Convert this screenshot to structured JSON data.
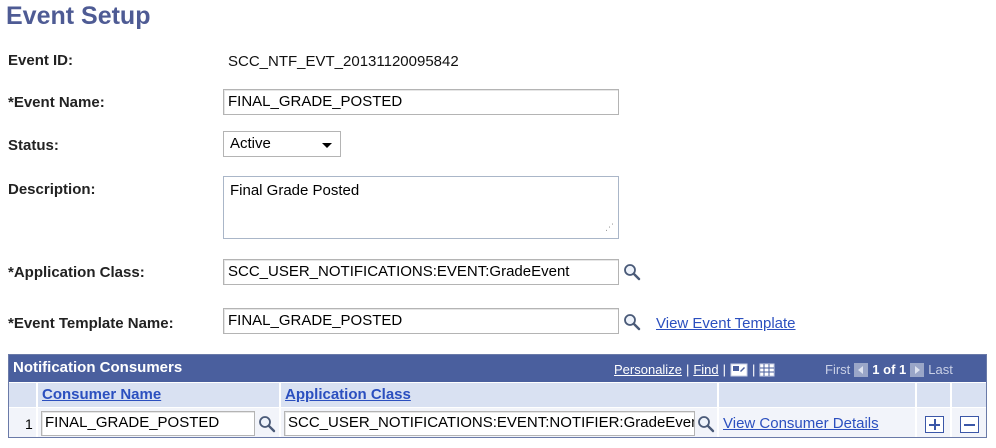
{
  "page": {
    "title": "Event Setup"
  },
  "form": {
    "event_id": {
      "label": "Event ID:",
      "value": "SCC_NTF_EVT_20131120095842"
    },
    "event_name": {
      "label": "*Event Name:",
      "value": "FINAL_GRADE_POSTED"
    },
    "status": {
      "label": "Status:",
      "value": "Active"
    },
    "description": {
      "label": "Description:",
      "value": "Final Grade Posted"
    },
    "application_class": {
      "label": "*Application Class:",
      "value": "SCC_USER_NOTIFICATIONS:EVENT:GradeEvent"
    },
    "event_template_name": {
      "label": "*Event Template Name:",
      "value": "FINAL_GRADE_POSTED",
      "link": "View Event Template"
    }
  },
  "grid": {
    "title": "Notification Consumers",
    "tools": {
      "personalize": "Personalize",
      "sep1": "|",
      "find": "Find",
      "sep2": "|",
      "sep3": "|"
    },
    "nav": {
      "first": "First",
      "count": "1 of 1",
      "last": "Last"
    },
    "columns": [
      "Consumer Name",
      "Application Class"
    ],
    "rows": [
      {
        "num": "1",
        "consumer_name": "FINAL_GRADE_POSTED",
        "application_class": "SCC_USER_NOTIFICATIONS:EVENT:NOTIFIER:GradeEvent",
        "link": "View Consumer Details"
      }
    ]
  },
  "colors": {
    "title": "#4e5b94",
    "grid_header": "#4a5f9e",
    "link": "#2b4fbf"
  },
  "icons": [
    "lookup-icon",
    "view-all-icon",
    "download-icon",
    "first-arrow-icon",
    "last-arrow-icon",
    "add-row-icon",
    "delete-row-icon"
  ]
}
